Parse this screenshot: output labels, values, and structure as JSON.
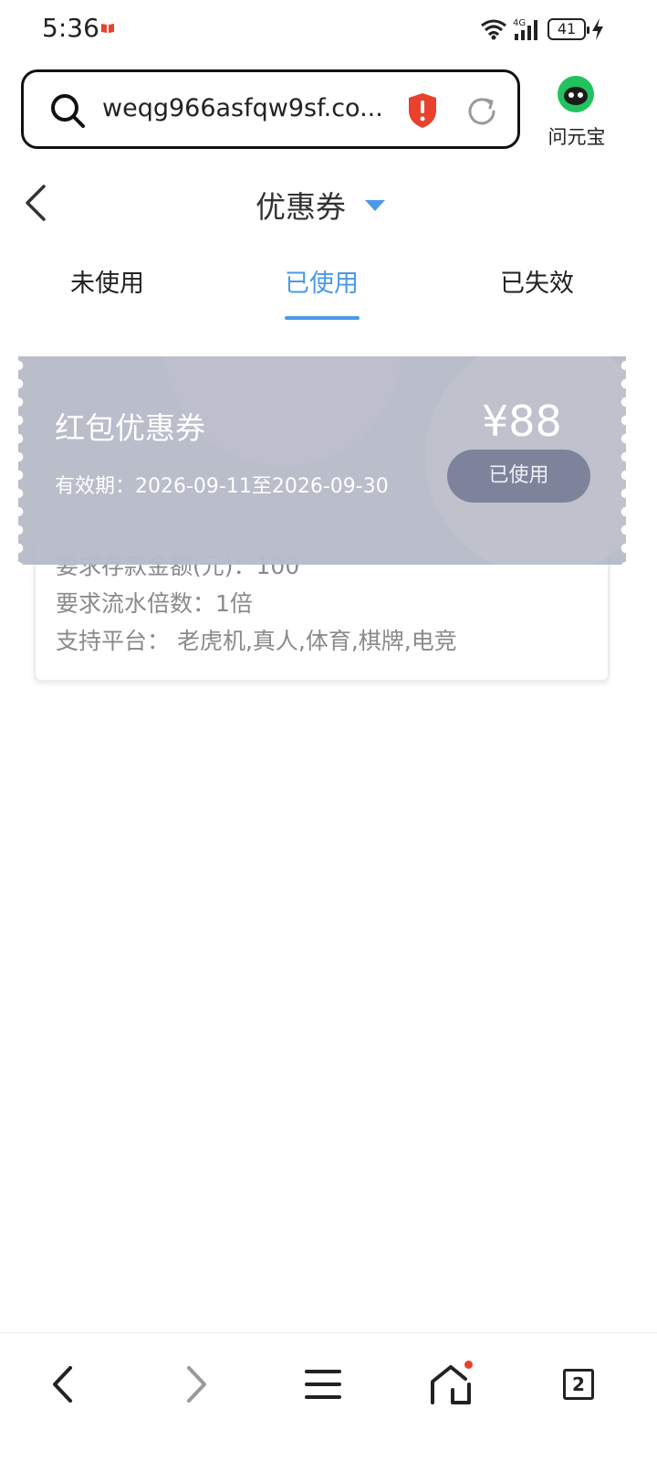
{
  "status_bar": {
    "time": "5:36",
    "network": "4G",
    "battery": "41"
  },
  "browser": {
    "url": "weqg966asfqw9sf.co...",
    "assistant_label": "问元宝"
  },
  "page": {
    "title": "优惠券"
  },
  "tabs": [
    {
      "label": "未使用"
    },
    {
      "label": "已使用"
    },
    {
      "label": "已失效"
    }
  ],
  "coupon": {
    "name": "红包优惠券",
    "validity": "有效期：2026-09-11至2026-09-30",
    "amount": "¥88",
    "status": "已使用",
    "deposit_requirement": "要求存款金额(元)：100",
    "turnover_requirement": "要求流水倍数：1倍",
    "platforms": "支持平台：  老虎机,真人,体育,棋牌,电竞"
  },
  "bottom_nav": {
    "tab_count": "2"
  },
  "colors": {
    "accent": "#4a9ae8",
    "coupon_bg": "#b8bbc9",
    "status_pill": "#7a8099",
    "shield": "#e8412e",
    "assistant": "#22c35e"
  }
}
